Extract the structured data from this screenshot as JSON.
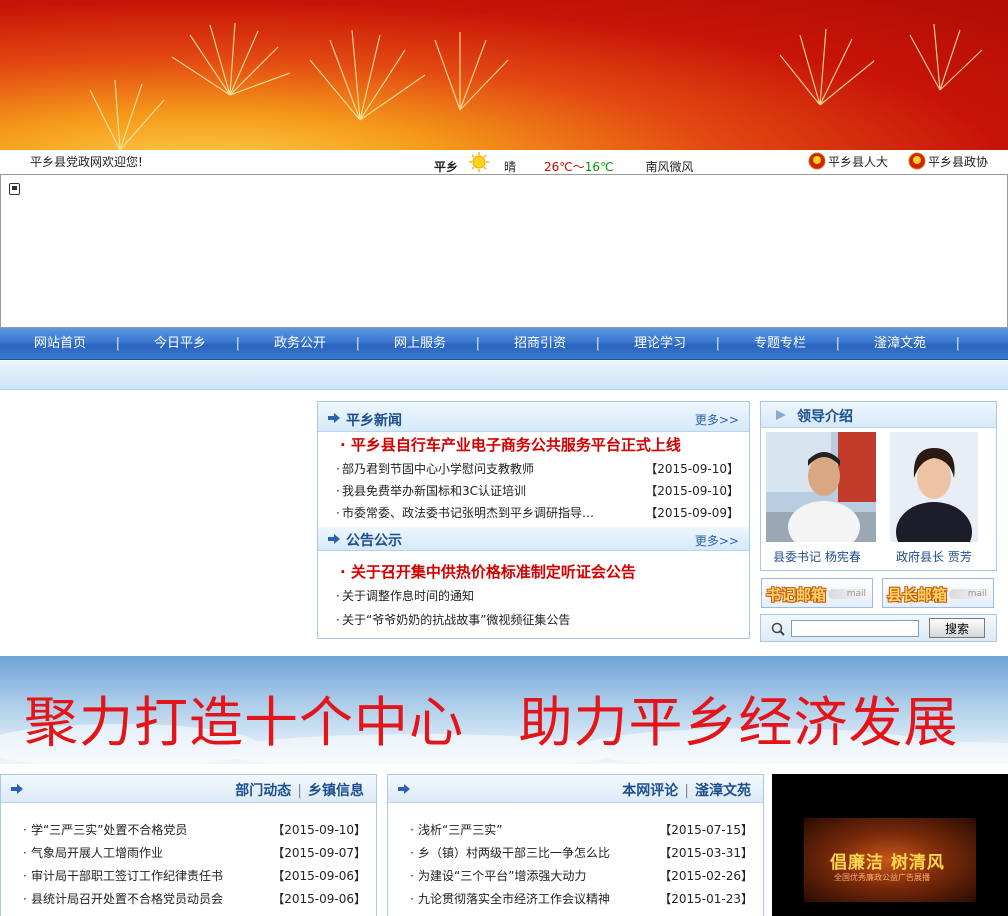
{
  "header": {
    "welcome": "平乡县党政网欢迎您!",
    "weather": {
      "city": "平乡",
      "icon": "sun-icon",
      "condition": "晴",
      "temp_high": "26℃",
      "temp_sep": "～",
      "temp_low": "16℃",
      "wind": "南风微风"
    },
    "links": [
      {
        "label": "平乡县人大",
        "icon": "emblem-icon"
      },
      {
        "label": "平乡县政协",
        "icon": "emblem-icon"
      }
    ]
  },
  "nav": {
    "items": [
      "网站首页",
      "今日平乡",
      "政务公开",
      "网上服务",
      "招商引资",
      "理论学习",
      "专题专栏",
      "滏漳文苑"
    ]
  },
  "news": {
    "title": "平乡新闻",
    "more": "更多>>",
    "headline": "· 平乡县自行车产业电子商务公共服务平台正式上线",
    "items": [
      {
        "title": "部乃君到节固中心小学慰问支教教师",
        "date": "【2015-09-10】"
      },
      {
        "title": "我县免费举办新国标和3C认证培训",
        "date": "【2015-09-10】"
      },
      {
        "title": "市委常委、政法委书记张明杰到平乡调研指导…",
        "date": "【2015-09-09】"
      }
    ]
  },
  "notice": {
    "title": "公告公示",
    "more": "更多>>",
    "headline": "· 关于召开集中供热价格标准制定听证会公告",
    "items": [
      {
        "title": "关于调整作息时间的通知"
      },
      {
        "title": "关于“爷爷奶奶的抗战故事”微视频征集公告"
      }
    ]
  },
  "leaders": {
    "title": "领导介绍",
    "people": [
      {
        "caption": "县委书记 杨宪春"
      },
      {
        "caption": "政府县长 贾芳"
      }
    ],
    "mailboxes": [
      {
        "label": "书记邮箱"
      },
      {
        "label": "县长邮箱"
      }
    ],
    "mail_suffix": "mail",
    "search": {
      "placeholder": "",
      "button": "搜索"
    }
  },
  "slogan": {
    "text": "聚力打造十个中心   助力平乡经济发展"
  },
  "dept": {
    "tabs": [
      "部门动态",
      "乡镇信息"
    ],
    "items": [
      {
        "title": "学“三严三实”处置不合格党员",
        "date": "【2015-09-10】"
      },
      {
        "title": "气象局开展人工增雨作业",
        "date": "【2015-09-07】"
      },
      {
        "title": "审计局干部职工签订工作纪律责任书",
        "date": "【2015-09-06】"
      },
      {
        "title": "县统计局召开处置不合格党员动员会",
        "date": "【2015-09-06】"
      }
    ]
  },
  "comment": {
    "tabs": [
      "本网评论",
      "滏漳文苑"
    ],
    "items": [
      {
        "title": "浅析“三严三实”",
        "date": "【2015-07-15】"
      },
      {
        "title": "乡（镇）村两级干部三比一争怎么比",
        "date": "【2015-03-31】"
      },
      {
        "title": "为建设“三个平台”增添强大动力",
        "date": "【2015-02-26】"
      },
      {
        "title": "九论贯彻落实全市经济工作会议精神",
        "date": "【2015-01-23】"
      }
    ]
  },
  "video": {
    "title": "倡廉洁 树清风",
    "subtitle": "全国优秀廉政公益广告展播"
  },
  "colors": {
    "nav": "#3a78d1",
    "headline": "#d40000",
    "title": "#1d4f8e",
    "slogan": "#e4151a"
  }
}
